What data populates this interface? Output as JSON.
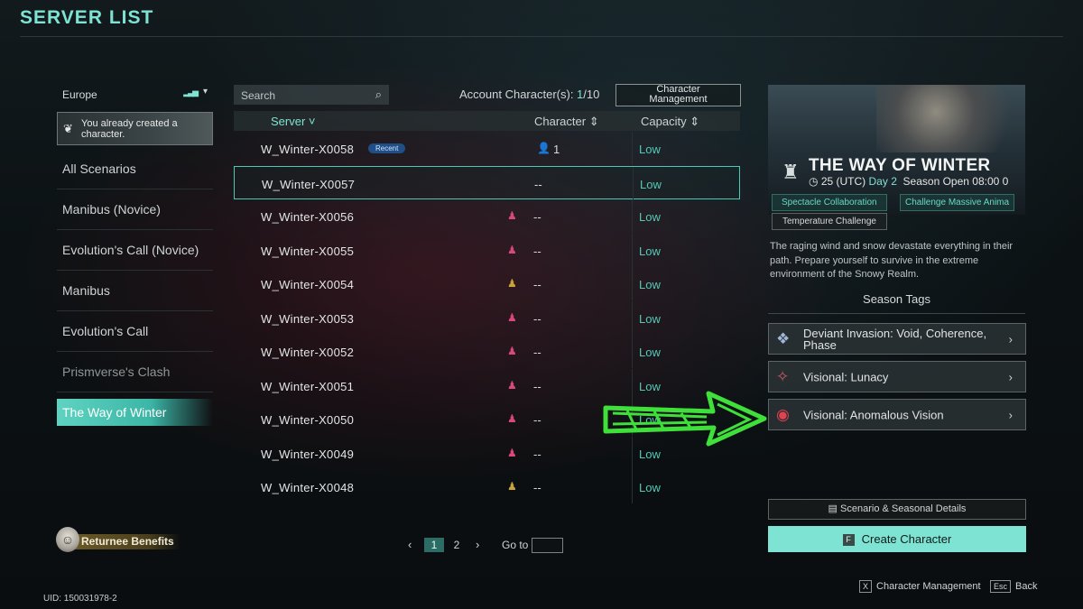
{
  "header": {
    "title": "SERVER LIST"
  },
  "sidebar": {
    "region": "Europe",
    "created_notice": "You already created a character.",
    "scenarios": [
      {
        "label": "All Scenarios",
        "state": "normal"
      },
      {
        "label": "Manibus (Novice)",
        "state": "normal"
      },
      {
        "label": "Evolution's Call (Novice)",
        "state": "normal"
      },
      {
        "label": "Manibus",
        "state": "normal"
      },
      {
        "label": "Evolution's Call",
        "state": "normal"
      },
      {
        "label": "Prismverse's Clash",
        "state": "dim"
      },
      {
        "label": "The Way of Winter",
        "state": "active"
      }
    ],
    "returnee_label": "Returnee Benefits",
    "uid": "UID: 150031978-2"
  },
  "search": {
    "placeholder": "Search"
  },
  "account": {
    "label": "Account Character(s): ",
    "count": "1",
    "max": "/10"
  },
  "char_mgmt_button": {
    "line1": "Character",
    "line2": "Management"
  },
  "table": {
    "headers": {
      "server": "Server ˅",
      "character": "Character ⇕",
      "capacity": "Capacity ⇕"
    },
    "rows": [
      {
        "name": "W_Winter-X0058",
        "badge": "Recent",
        "chars": "1",
        "fig": "person",
        "capacity": "Low"
      },
      {
        "name": "W_Winter-X0057",
        "badge": "",
        "chars": "--",
        "fig": "",
        "capacity": "Low",
        "selected": true
      },
      {
        "name": "W_Winter-X0056",
        "badge": "",
        "chars": "--",
        "fig": "pink",
        "capacity": "Low"
      },
      {
        "name": "W_Winter-X0055",
        "badge": "",
        "chars": "--",
        "fig": "pink",
        "capacity": "Low"
      },
      {
        "name": "W_Winter-X0054",
        "badge": "",
        "chars": "--",
        "fig": "gold",
        "capacity": "Low"
      },
      {
        "name": "W_Winter-X0053",
        "badge": "",
        "chars": "--",
        "fig": "pink",
        "capacity": "Low"
      },
      {
        "name": "W_Winter-X0052",
        "badge": "",
        "chars": "--",
        "fig": "pink",
        "capacity": "Low"
      },
      {
        "name": "W_Winter-X0051",
        "badge": "",
        "chars": "--",
        "fig": "pink",
        "capacity": "Low"
      },
      {
        "name": "W_Winter-X0050",
        "badge": "",
        "chars": "--",
        "fig": "pink",
        "capacity": "Low"
      },
      {
        "name": "W_Winter-X0049",
        "badge": "",
        "chars": "--",
        "fig": "pink",
        "capacity": "Low"
      },
      {
        "name": "W_Winter-X0048",
        "badge": "",
        "chars": "--",
        "fig": "gold",
        "capacity": "Low"
      }
    ]
  },
  "pager": {
    "prev": "‹",
    "pages": [
      "1",
      "2"
    ],
    "current": "1",
    "next": "›",
    "goto_label": "Go to"
  },
  "season": {
    "title": "THE WAY OF WINTER",
    "time": "25 (UTC)",
    "day": "Day 2",
    "open": "Season Open 08:00 0",
    "tags": [
      "Spectacle Collaboration",
      "Challenge Massive Anima",
      "Temperature Challenge"
    ],
    "description": "The raging wind and snow devastate everything in their path. Prepare yourself to survive in the extreme environment of the Snowy Realm.",
    "season_tags_title": "Season Tags",
    "season_tags": [
      {
        "label": "Deviant Invasion: Void, Coherence, Phase",
        "icon": "deviant-icon"
      },
      {
        "label": "Visional: Lunacy",
        "icon": "lunacy-icon"
      },
      {
        "label": "Visional: Anomalous Vision",
        "icon": "anomalous-vision-icon"
      }
    ],
    "details_button": "Scenario & Seasonal Details",
    "create_button": "Create Character",
    "create_key": "F"
  },
  "hints": {
    "char_mgmt_key": "X",
    "char_mgmt_label": "Character Management",
    "back_key": "Esc",
    "back_label": "Back"
  },
  "colors": {
    "accent": "#7fe3d4",
    "capacity_low": "#55c9b8",
    "annotation": "#3fe03a"
  }
}
